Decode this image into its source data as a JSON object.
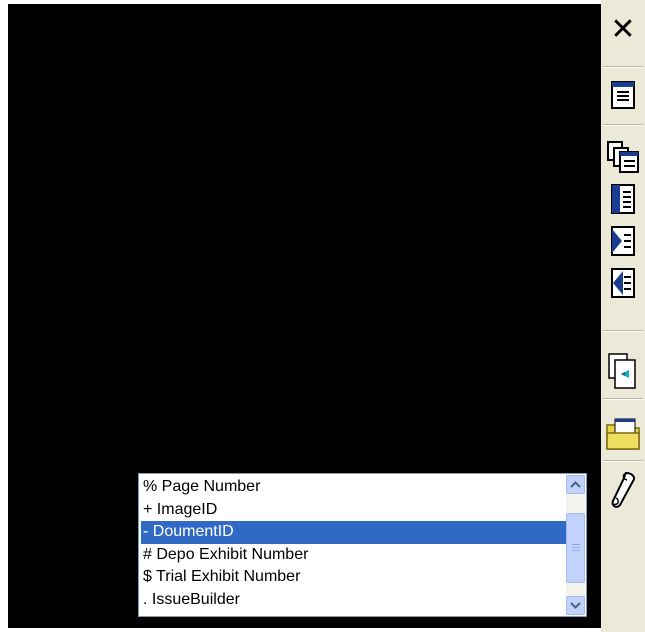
{
  "toolbar": {
    "close_label": "✕",
    "buttons": [
      {
        "name": "document-view-icon"
      },
      {
        "name": "multi-page-icon"
      },
      {
        "name": "first-page-icon"
      },
      {
        "name": "next-page-icon"
      },
      {
        "name": "previous-page-icon"
      },
      {
        "name": "import-document-icon"
      },
      {
        "name": "open-folder-icon"
      },
      {
        "name": "scroll-icon"
      }
    ]
  },
  "listbox": {
    "selected_index": 2,
    "items": [
      {
        "label": "% Page Number"
      },
      {
        "label": "+ ImageID"
      },
      {
        "label": "- DoumentID"
      },
      {
        "label": "# Depo Exhibit Number"
      },
      {
        "label": "$ Trial Exhibit Number"
      },
      {
        "label": ". IssueBuilder"
      }
    ]
  },
  "colors": {
    "viewport": "#000000",
    "toolbar_bg": "#ece9d8",
    "selection": "#316ac5"
  }
}
